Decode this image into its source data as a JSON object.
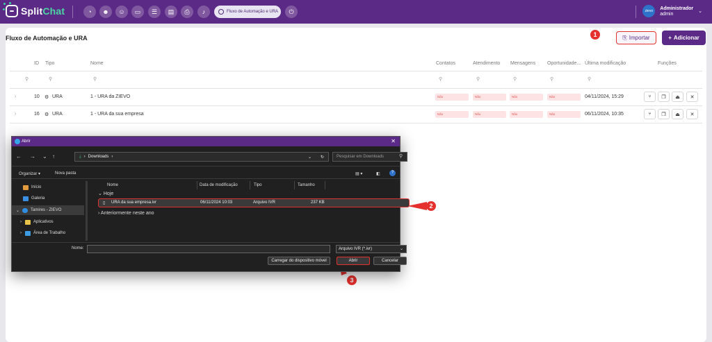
{
  "brand": {
    "part1": "Split",
    "part2": "Chat"
  },
  "nav": {
    "active_pill": "Fluxo de Automação e URA"
  },
  "user": {
    "name": "Administrador",
    "role": "admin",
    "avatar": "zievo"
  },
  "page": {
    "title": "Fluxo de Automação e URA",
    "import_label": "Importar",
    "add_label": "Adicionar"
  },
  "table": {
    "headers": {
      "id": "ID",
      "tipo": "Tipo",
      "nome": "Nome",
      "contatos": "Contatos",
      "atendimento": "Atendimento",
      "mensagens": "Mensagens",
      "oportunidades": "Oportunidade...",
      "modificacao": "Última modificação",
      "funcoes": "Funções"
    },
    "rows": [
      {
        "id": "10",
        "tipo": "URA",
        "nome": "1 - URA da ZIEVO",
        "flag": "Não",
        "modified": "04/11/2024, 15:29"
      },
      {
        "id": "16",
        "tipo": "URA",
        "nome": "1 - URA da sua empresa",
        "flag": "Não",
        "modified": "06/11/2024, 10:35"
      }
    ]
  },
  "badges": {
    "b1": "1",
    "b2": "2",
    "b3": "3"
  },
  "dialog": {
    "title": "Abrir",
    "path": "Downloads",
    "search_placeholder": "Pesquisar em Downloads",
    "organize": "Organizar",
    "new_folder": "Nova pasta",
    "sidebar": [
      "Início",
      "Galeria",
      "Tamires - ZIEVO",
      "Aplicativos",
      "Área de Trabalho"
    ],
    "columns": {
      "nome": "Nome",
      "data": "Data de modificação",
      "tipo": "Tipo",
      "tamanho": "Tamanho"
    },
    "group_today": "Hoje",
    "group_earlier": "Anteriormente neste ano",
    "file": {
      "name": "URA da sua empresa.ivr",
      "date": "06/11/2024 10:03",
      "type": "Arquivo IVR",
      "size": "237 KB"
    },
    "name_label": "Nome:",
    "filetype": "Arquivo IVR (*.ivr)",
    "mobile_btn": "Carregar do dispositivo móvel",
    "open_btn": "Abrir",
    "cancel_btn": "Cancelar"
  },
  "colors": {
    "primary": "#5b2a86",
    "highlight": "#e5312e",
    "accent": "#4bd6a4"
  }
}
